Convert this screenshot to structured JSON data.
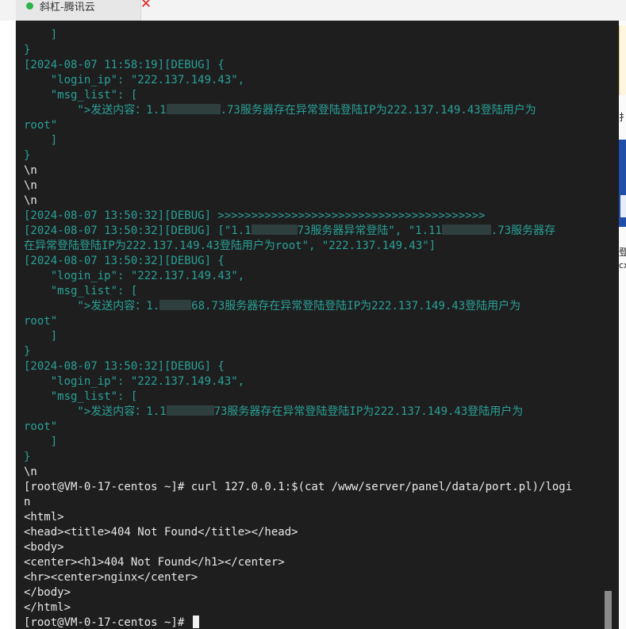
{
  "tab": {
    "title": "斜杠-腾讯云",
    "close_glyph": "✕",
    "status_color": "#2cb34a"
  },
  "terminal": {
    "lines": [
      {
        "t": "    ]"
      },
      {
        "t": "}"
      },
      {
        "t": "[2024-08-07 11:58:19][DEBUG] {"
      },
      {
        "t": "    \"login_ip\": \"222.137.149.43\","
      },
      {
        "t": "    \"msg_list\": ["
      },
      {
        "t": "        \">发送内容：1.1",
        "redact": 68,
        "t2": ".73服务器存在异常登陆登陆IP为222.137.149.43登陆用户为"
      },
      {
        "t": "root\""
      },
      {
        "t": "    ]"
      },
      {
        "t": "}"
      },
      {
        "t": "\\n",
        "c": "w"
      },
      {
        "t": "\\n",
        "c": "w"
      },
      {
        "t": "\\n",
        "c": "w"
      },
      {
        "t": "[2024-08-07 13:50:32][DEBUG] >>>>>>>>>>>>>>>>>>>>>>>>>>>>>>>>>>>>>>>>"
      },
      {
        "t": "[2024-08-07 13:50:32][DEBUG] [\"1.1",
        "redact": 58,
        "t2": "73服务器异常登陆\", \"1.11",
        "redact2": 62,
        "t3": ".73服务器存"
      },
      {
        "t": "在异常登陆登陆IP为222.137.149.43登陆用户为root\", \"222.137.149.43\"]"
      },
      {
        "t": "[2024-08-07 13:50:32][DEBUG] {"
      },
      {
        "t": "    \"login_ip\": \"222.137.149.43\","
      },
      {
        "t": "    \"msg_list\": ["
      },
      {
        "t": "        \">发送内容：1.",
        "redact": 40,
        "t2": "68.73服务器存在异常登陆登陆IP为222.137.149.43登陆用户为"
      },
      {
        "t": "root\""
      },
      {
        "t": "    ]"
      },
      {
        "t": "}"
      },
      {
        "t": "[2024-08-07 13:50:32][DEBUG] {"
      },
      {
        "t": "    \"login_ip\": \"222.137.149.43\","
      },
      {
        "t": "    \"msg_list\": ["
      },
      {
        "t": "        \">发送内容：1.1",
        "redact": 60,
        "t2": "73服务器存在异常登陆登陆IP为222.137.149.43登陆用户为"
      },
      {
        "t": "root\""
      },
      {
        "t": "    ]"
      },
      {
        "t": "}"
      },
      {
        "t": "\\n",
        "c": "w"
      },
      {
        "t": "[root@VM-0-17-centos ~]# curl 127.0.0.1:$(cat /www/server/panel/data/port.pl)/logi",
        "c": "w"
      },
      {
        "t": "n",
        "c": "w"
      },
      {
        "t": "<html>",
        "c": "w"
      },
      {
        "t": "<head><title>404 Not Found</title></head>",
        "c": "w"
      },
      {
        "t": "<body>",
        "c": "w"
      },
      {
        "t": "<center><h1>404 Not Found</h1></center>",
        "c": "w"
      },
      {
        "t": "<hr><center>nginx</center>",
        "c": "w"
      },
      {
        "t": "</body>",
        "c": "w"
      },
      {
        "t": "</html>",
        "c": "w"
      },
      {
        "t": "[root@VM-0-17-centos ~]# ",
        "c": "w",
        "cursor": true
      }
    ]
  },
  "right_edge": {
    "texts": [
      "扌",
      "登",
      "cx"
    ]
  }
}
